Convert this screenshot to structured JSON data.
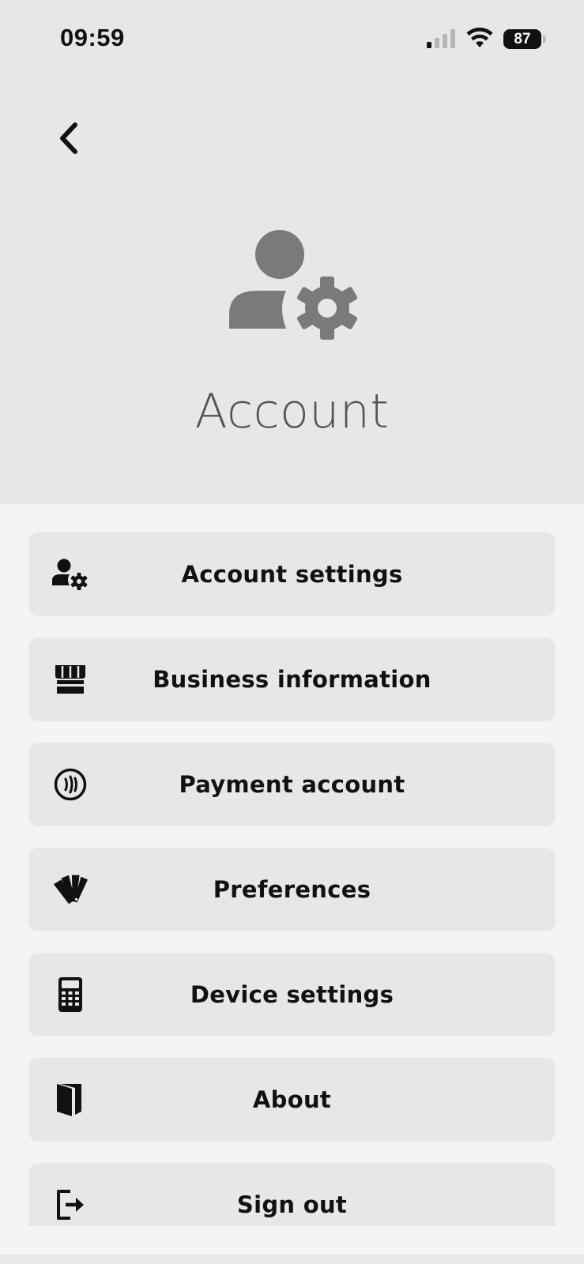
{
  "status_bar": {
    "time": "09:59",
    "battery": "87",
    "signal_icon": "cellular-signal-icon",
    "wifi_icon": "wifi-icon"
  },
  "header": {
    "back_icon": "chevron-left-icon",
    "hero_icon": "user-gear-icon",
    "title": "Account"
  },
  "menu": {
    "items": [
      {
        "label": "Account settings",
        "icon": "user-gear-icon"
      },
      {
        "label": "Business information",
        "icon": "storefront-icon"
      },
      {
        "label": "Payment account",
        "icon": "contactless-icon"
      },
      {
        "label": "Preferences",
        "icon": "color-swatches-icon"
      },
      {
        "label": "Device settings",
        "icon": "calculator-icon"
      },
      {
        "label": "About",
        "icon": "book-icon"
      },
      {
        "label": "Sign out",
        "icon": "sign-out-icon"
      }
    ]
  },
  "colors": {
    "header_bg": "#e7e7e7",
    "page_bg": "#f4f4f4",
    "card_bg": "#e7e7e7",
    "text": "#111111",
    "hero_icon": "#7a7a7a"
  }
}
